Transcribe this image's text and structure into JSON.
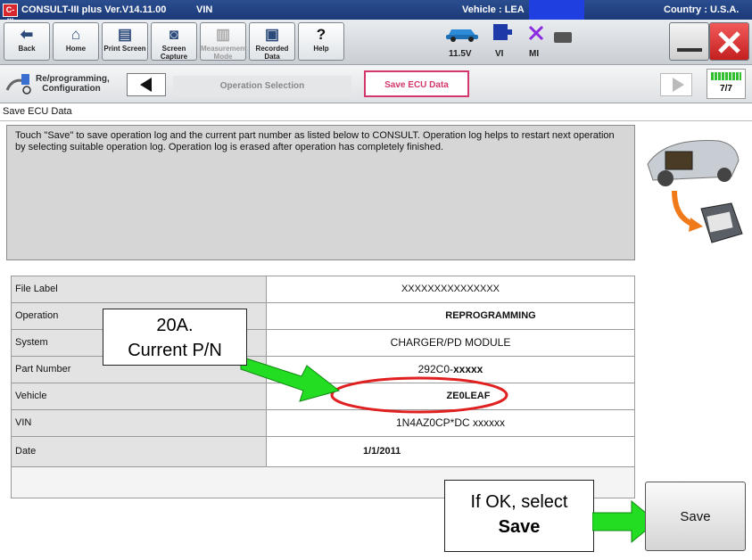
{
  "titlebar": {
    "app_icon": "C-III",
    "app_title": "CONSULT-III plus  Ver.V14.11.00",
    "vin_label": "VIN",
    "vehicle_label": "Vehicle : LEA",
    "country_label": "Country : U.S.A."
  },
  "toolbar": {
    "back": "Back",
    "home": "Home",
    "print_screen": "Print Screen",
    "screen_capture": "Screen Capture",
    "measurement_mode": "Measurement Mode",
    "recorded_data": "Recorded Data",
    "help": "Help",
    "voltage": "11.5V",
    "vi": "VI",
    "mi": "MI"
  },
  "nav": {
    "reprogramming": "Re/programming, Configuration",
    "operation_selection": "Operation Selection",
    "save_ecu_data": "Save ECU Data",
    "progress": "7/7"
  },
  "section_title": "Save ECU Data",
  "message": "Touch \"Save\" to save operation log and the current part number as listed below to CONSULT. Operation log helps to restart next operation by selecting suitable operation log. Operation log is erased after operation has completely finished.",
  "table": {
    "rows": [
      {
        "label": "File Label",
        "value": "XXXXXXXXXXXXXXX"
      },
      {
        "label": "Operation",
        "value": "REPROGRAMMING"
      },
      {
        "label": "System",
        "value": "CHARGER/PD MODULE"
      },
      {
        "label": "Part Number",
        "value_prefix": "292C0-",
        "value_suffix": "xxxxx"
      },
      {
        "label": "Vehicle",
        "value": "ZE0LEAF"
      },
      {
        "label": "VIN",
        "value": "1N4AZ0CP*DC xxxxxx"
      },
      {
        "label": "Date",
        "value": "1/1/2011"
      }
    ]
  },
  "callout_pn": {
    "line1": "20A.",
    "line2": "Current P/N"
  },
  "callout_save": {
    "line1": "If OK, select",
    "line2": "Save"
  },
  "save_button": "Save",
  "colors": {
    "accent_pink": "#d4366e",
    "callout_arrow": "#22dd22",
    "highlight_ring": "#e02020"
  }
}
